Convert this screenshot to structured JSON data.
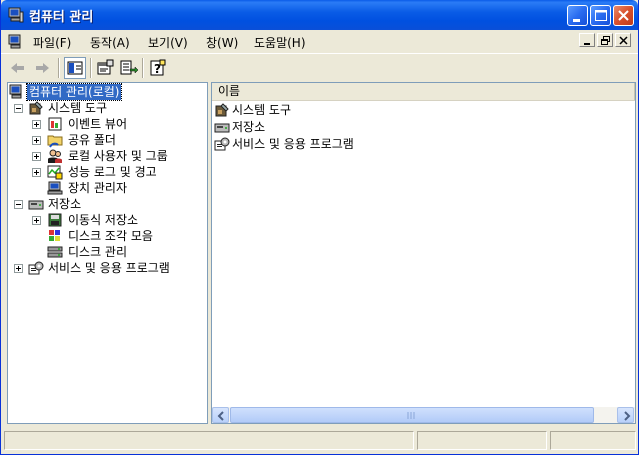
{
  "window": {
    "title": "컴퓨터 관리",
    "title_icon": "computer-management-icon"
  },
  "menu": {
    "items": [
      {
        "label": "파일(F)"
      },
      {
        "label": "동작(A)"
      },
      {
        "label": "보기(V)"
      },
      {
        "label": "창(W)"
      },
      {
        "label": "도움말(H)"
      }
    ]
  },
  "toolbar": {
    "buttons": [
      "back-arrow-icon",
      "forward-arrow-icon",
      "show-hide-tree-icon",
      "properties-icon",
      "export-list-icon",
      "help-icon"
    ]
  },
  "tree": {
    "root": "컴퓨터 관리(로컬)",
    "items": [
      {
        "label": "시스템 도구",
        "icon": "system-tools-icon"
      },
      {
        "label": "이벤트 뷰어",
        "icon": "event-viewer-icon"
      },
      {
        "label": "공유 폴더",
        "icon": "shared-folders-icon"
      },
      {
        "label": "로컬 사용자 및 그룹",
        "icon": "users-groups-icon"
      },
      {
        "label": "성능 로그 및 경고",
        "icon": "performance-logs-icon"
      },
      {
        "label": "장치 관리자",
        "icon": "device-manager-icon"
      },
      {
        "label": "저장소",
        "icon": "storage-icon"
      },
      {
        "label": "이동식 저장소",
        "icon": "removable-storage-icon"
      },
      {
        "label": "디스크 조각 모음",
        "icon": "defragmenter-icon"
      },
      {
        "label": "디스크 관리",
        "icon": "disk-management-icon"
      },
      {
        "label": "서비스 및 응용 프로그램",
        "icon": "services-applications-icon"
      }
    ]
  },
  "list": {
    "column_header": "이름",
    "items": [
      {
        "label": "시스템 도구"
      },
      {
        "label": "저장소"
      },
      {
        "label": "서비스 및 응용 프로그램"
      }
    ]
  },
  "colors": {
    "title_bar": "#0a5ce6",
    "selection": "#316ac5",
    "window_bg": "#ece9d8"
  }
}
